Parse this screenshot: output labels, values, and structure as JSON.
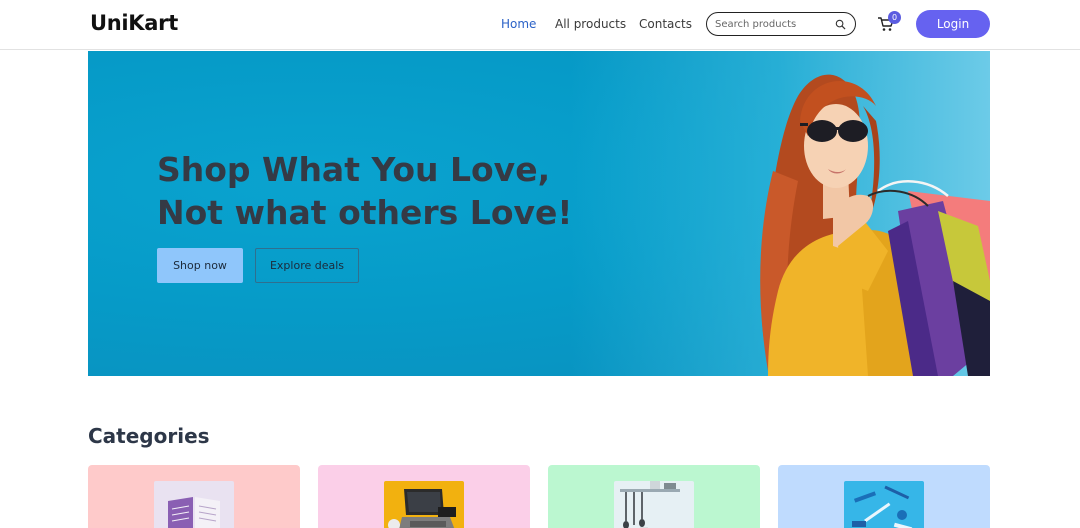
{
  "header": {
    "logo": "UniKart",
    "nav": [
      {
        "label": "Home",
        "active": true
      },
      {
        "label": "All products",
        "active": false
      },
      {
        "label": "Contacts",
        "active": false
      }
    ],
    "search": {
      "placeholder": "Search products",
      "value": ""
    },
    "cart": {
      "count": "0"
    },
    "login_label": "Login"
  },
  "hero": {
    "title_line1": "Shop What You Love,",
    "title_line2": "Not what others Love!",
    "primary_button": "Shop now",
    "secondary_button": "Explore deals"
  },
  "categories": {
    "title": "Categories",
    "cards": [
      {
        "image": "book-image",
        "color": "#fecaca"
      },
      {
        "image": "laptop-image",
        "color": "#fbcfe8"
      },
      {
        "image": "kitchen-tools-image",
        "color": "#bbf7d0"
      },
      {
        "image": "stationery-image",
        "color": "#bfdbfe"
      }
    ]
  },
  "colors": {
    "accent": "#6662f0",
    "nav_active": "#2b62c7",
    "hero_bg": "#069bc8"
  }
}
